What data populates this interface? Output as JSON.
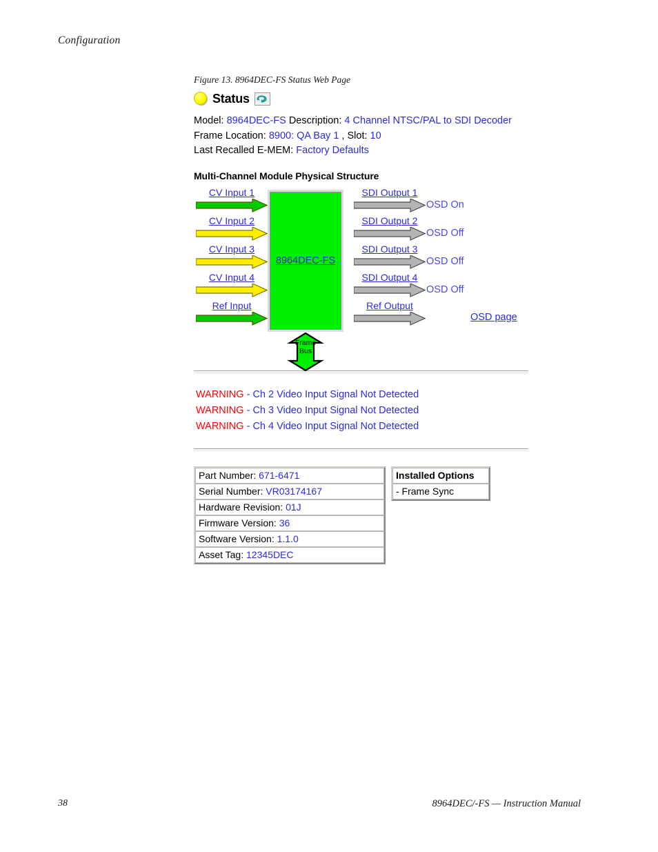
{
  "document": {
    "running_head": "Configuration",
    "page_number": "38",
    "footer_manual": "8964DEC/-FS — Instruction Manual",
    "figure_caption": "Figure 13.  8964DEC-FS Status Web Page"
  },
  "webpage": {
    "status_header": {
      "led_icon": "yellow-status-led-icon",
      "led_color": "#ffff00",
      "title": "Status",
      "refresh_icon": "refresh-icon"
    },
    "info": {
      "model_label": "Model:",
      "model_value": "8964DEC-FS",
      "description_label": "Description:",
      "description_value": "4 Channel NTSC/PAL to SDI Decoder",
      "frame_location_label": "Frame Location:",
      "frame_location_value": "8900: QA Bay 1",
      "slot_separator": ",",
      "slot_label": "Slot:",
      "slot_value": "10",
      "emem_label": "Last Recalled E-MEM:",
      "emem_value": "Factory Defaults"
    },
    "diagram": {
      "heading": "Multi-Channel Module Physical Structure",
      "module_label": "8964DEC-FS",
      "module_color": "#00ee00",
      "osd_page_link": "OSD page",
      "frame_bus": {
        "line1": "Frame",
        "line2": "Bus",
        "color": "#00ee00"
      },
      "inputs": [
        {
          "label": "CV Input 1",
          "arrow_color": "#00cc00",
          "state": "ok"
        },
        {
          "label": "CV Input 2",
          "arrow_color": "#ffee00",
          "state": "warning"
        },
        {
          "label": "CV Input 3",
          "arrow_color": "#ffee00",
          "state": "warning"
        },
        {
          "label": "CV Input 4",
          "arrow_color": "#ffee00",
          "state": "warning"
        },
        {
          "label": "Ref Input",
          "arrow_color": "#00cc00",
          "state": "ok"
        }
      ],
      "outputs": [
        {
          "label": "SDI Output 1",
          "arrow_color": "#a8a8a8",
          "osd": "OSD On"
        },
        {
          "label": "SDI Output 2",
          "arrow_color": "#a8a8a8",
          "osd": "OSD Off"
        },
        {
          "label": "SDI Output 3",
          "arrow_color": "#a8a8a8",
          "osd": "OSD Off"
        },
        {
          "label": "SDI Output 4",
          "arrow_color": "#a8a8a8",
          "osd": "OSD Off"
        },
        {
          "label": "Ref Output",
          "arrow_color": "#a8a8a8",
          "osd": ""
        }
      ]
    },
    "warnings": [
      {
        "keyword": "WARNING",
        "separator": " - ",
        "message": "Ch 2 Video Input Signal Not Detected"
      },
      {
        "keyword": "WARNING",
        "separator": " - ",
        "message": "Ch 3 Video Input Signal Not Detected"
      },
      {
        "keyword": "WARNING",
        "separator": " - ",
        "message": "Ch 4 Video Input Signal Not Detected"
      }
    ],
    "warning_color": "#ff0000",
    "link_color": "#2b2bdd",
    "properties": [
      {
        "label": "Part Number:",
        "value": "671-6471"
      },
      {
        "label": "Serial Number:",
        "value": "VR03174167"
      },
      {
        "label": "Hardware Revision:",
        "value": "01J"
      },
      {
        "label": "Firmware Version:",
        "value": "36"
      },
      {
        "label": "Software Version:",
        "value": "1.1.0"
      },
      {
        "label": "Asset Tag:",
        "value": "12345DEC"
      }
    ],
    "installed_options": {
      "header": "Installed Options",
      "items": [
        "- Frame Sync"
      ]
    }
  }
}
